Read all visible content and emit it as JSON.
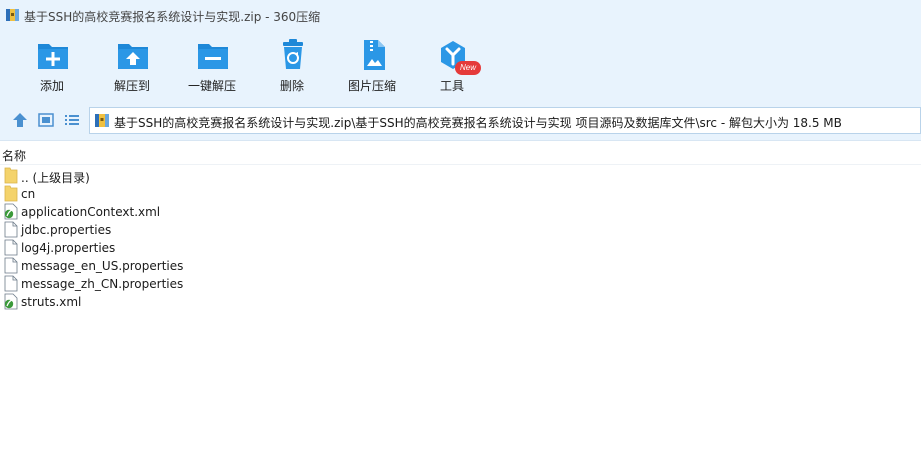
{
  "window": {
    "title": "基于SSH的高校竞赛报名系统设计与实现.zip - 360压缩"
  },
  "toolbar": {
    "items": [
      {
        "label": "添加",
        "icon": "add-icon"
      },
      {
        "label": "解压到",
        "icon": "extract-to-icon"
      },
      {
        "label": "一键解压",
        "icon": "one-click-extract-icon"
      },
      {
        "label": "删除",
        "icon": "delete-icon"
      },
      {
        "label": "图片压缩",
        "icon": "image-compress-icon"
      },
      {
        "label": "工具",
        "icon": "tools-icon"
      }
    ],
    "badge": "New"
  },
  "navigation": {
    "path": "基于SSH的高校竞赛报名系统设计与实现.zip\\基于SSH的高校竞赛报名系统设计与实现 项目源码及数据库文件\\src - 解包大小为 18.5 MB"
  },
  "columns": {
    "name": "名称"
  },
  "files": [
    {
      "name": ".. (上级目录)",
      "type": "folder"
    },
    {
      "name": "cn",
      "type": "folder"
    },
    {
      "name": "applicationContext.xml",
      "type": "xml"
    },
    {
      "name": "jdbc.properties",
      "type": "file"
    },
    {
      "name": "log4j.properties",
      "type": "file"
    },
    {
      "name": "message_en_US.properties",
      "type": "file"
    },
    {
      "name": "message_zh_CN.properties",
      "type": "file"
    },
    {
      "name": "struts.xml",
      "type": "xml"
    }
  ],
  "colors": {
    "accent": "#1e88d8",
    "toolbar_bg": "#e8f3fd",
    "badge": "#e53a3a",
    "folder": "#f4d36b"
  }
}
